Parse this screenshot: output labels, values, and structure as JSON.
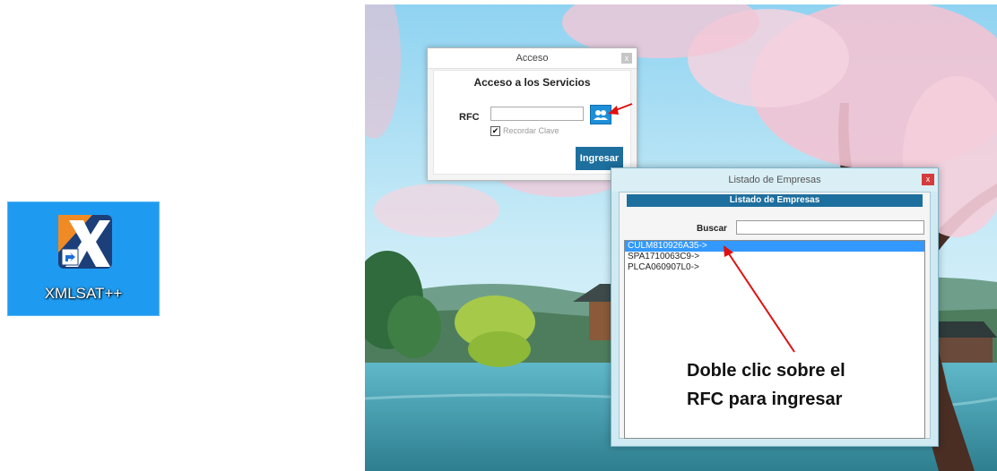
{
  "desktop": {
    "shortcut_label": "XMLSAT++",
    "shortcut_icon": "xmlsat-app-icon",
    "tile_color": "#1e9bf0"
  },
  "acceso_window": {
    "title": "Acceso",
    "close_glyph": "x",
    "heading": "Acceso a los Servicios",
    "rfc_label": "RFC",
    "rfc_value": "",
    "rfc_button_icon": "users-icon",
    "remember_label": "Recordar Clave",
    "remember_checked": true,
    "ingresar_label": "Ingresar",
    "accent": "#1d6f9e"
  },
  "listado_window": {
    "title": "Listado de Empresas",
    "close_glyph": "x",
    "header_bar": "Listado de Empresas",
    "search_label": "Buscar",
    "search_value": "",
    "items": [
      {
        "label": "CULM810926A35->",
        "selected": true
      },
      {
        "label": "SPA1710063C9->",
        "selected": false
      },
      {
        "label": "PLCA060907L0->",
        "selected": false
      }
    ],
    "close_color": "#d73a3a"
  },
  "annotation": {
    "line1": "Doble clic sobre el",
    "line2": "RFC para ingresar",
    "arrow_color": "#e01010"
  }
}
